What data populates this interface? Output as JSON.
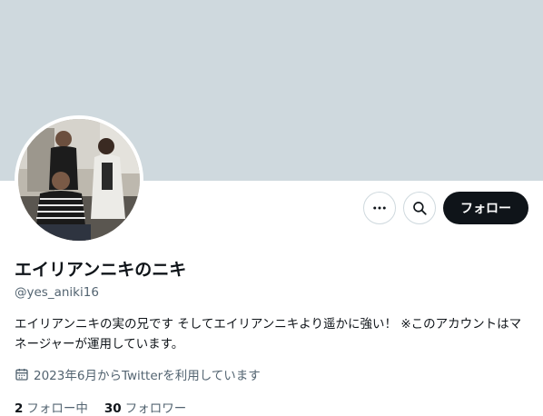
{
  "profile": {
    "display_name": "エイリアンニキのニキ",
    "handle": "@yes_aniki16",
    "bio": "エイリアンニキの実の兄です そしてエイリアンニキより遥かに強い！ ※このアカウントはマネージャーが運用しています。",
    "joined": "2023年6月からTwitterを利用しています",
    "following_count": "2",
    "following_label": "フォロー中",
    "followers_count": "30",
    "followers_label": "フォロワー"
  },
  "actions": {
    "follow_label": "フォロー",
    "more_icon": "more-horizontal-icon",
    "search_icon": "search-icon"
  },
  "colors": {
    "banner": "#cfd9de",
    "primary_text": "#0f1419",
    "secondary_text": "#536471",
    "follow_button_bg": "#0f1419"
  }
}
